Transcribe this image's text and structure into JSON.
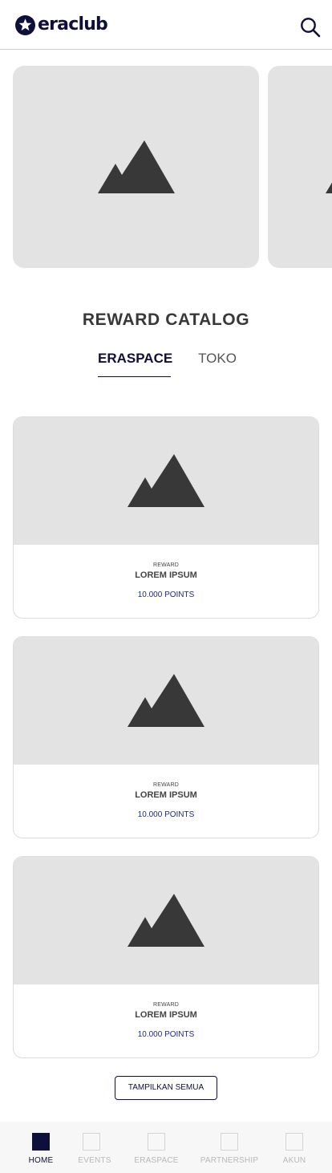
{
  "header": {
    "logo_text": "eraclub",
    "logo_icon": "star-badge-icon",
    "search_icon": "search-icon"
  },
  "carousel": {
    "slides": [
      {
        "image": "image-placeholder-icon"
      },
      {
        "image": "image-placeholder-icon"
      }
    ]
  },
  "section": {
    "title": "REWARD CATALOG"
  },
  "tabs": [
    {
      "label": "ERASPACE",
      "active": true
    },
    {
      "label": "TOKO",
      "active": false
    }
  ],
  "rewards": [
    {
      "kicker": "REWARD",
      "title": "LOREM IPSUM",
      "points": "10.000 POINTS",
      "image": "image-placeholder-icon"
    },
    {
      "kicker": "REWARD",
      "title": "LOREM IPSUM",
      "points": "10.000 POINTS",
      "image": "image-placeholder-icon"
    },
    {
      "kicker": "REWARD",
      "title": "LOREM IPSUM",
      "points": "10.000 POINTS",
      "image": "image-placeholder-icon"
    }
  ],
  "show_all_label": "TAMPILKAN SEMUA",
  "bottom_nav": [
    {
      "label": "HOME",
      "active": true
    },
    {
      "label": "EVENTS",
      "active": false
    },
    {
      "label": "ERASPACE",
      "active": false
    },
    {
      "label": "PARTNERSHIP",
      "active": false
    },
    {
      "label": "AKUN",
      "active": false
    }
  ],
  "colors": {
    "brand": "#0f0f3b",
    "points": "#1a2a8c",
    "placeholder_bg": "#e3e3e3",
    "placeholder_icon": "#383838"
  }
}
